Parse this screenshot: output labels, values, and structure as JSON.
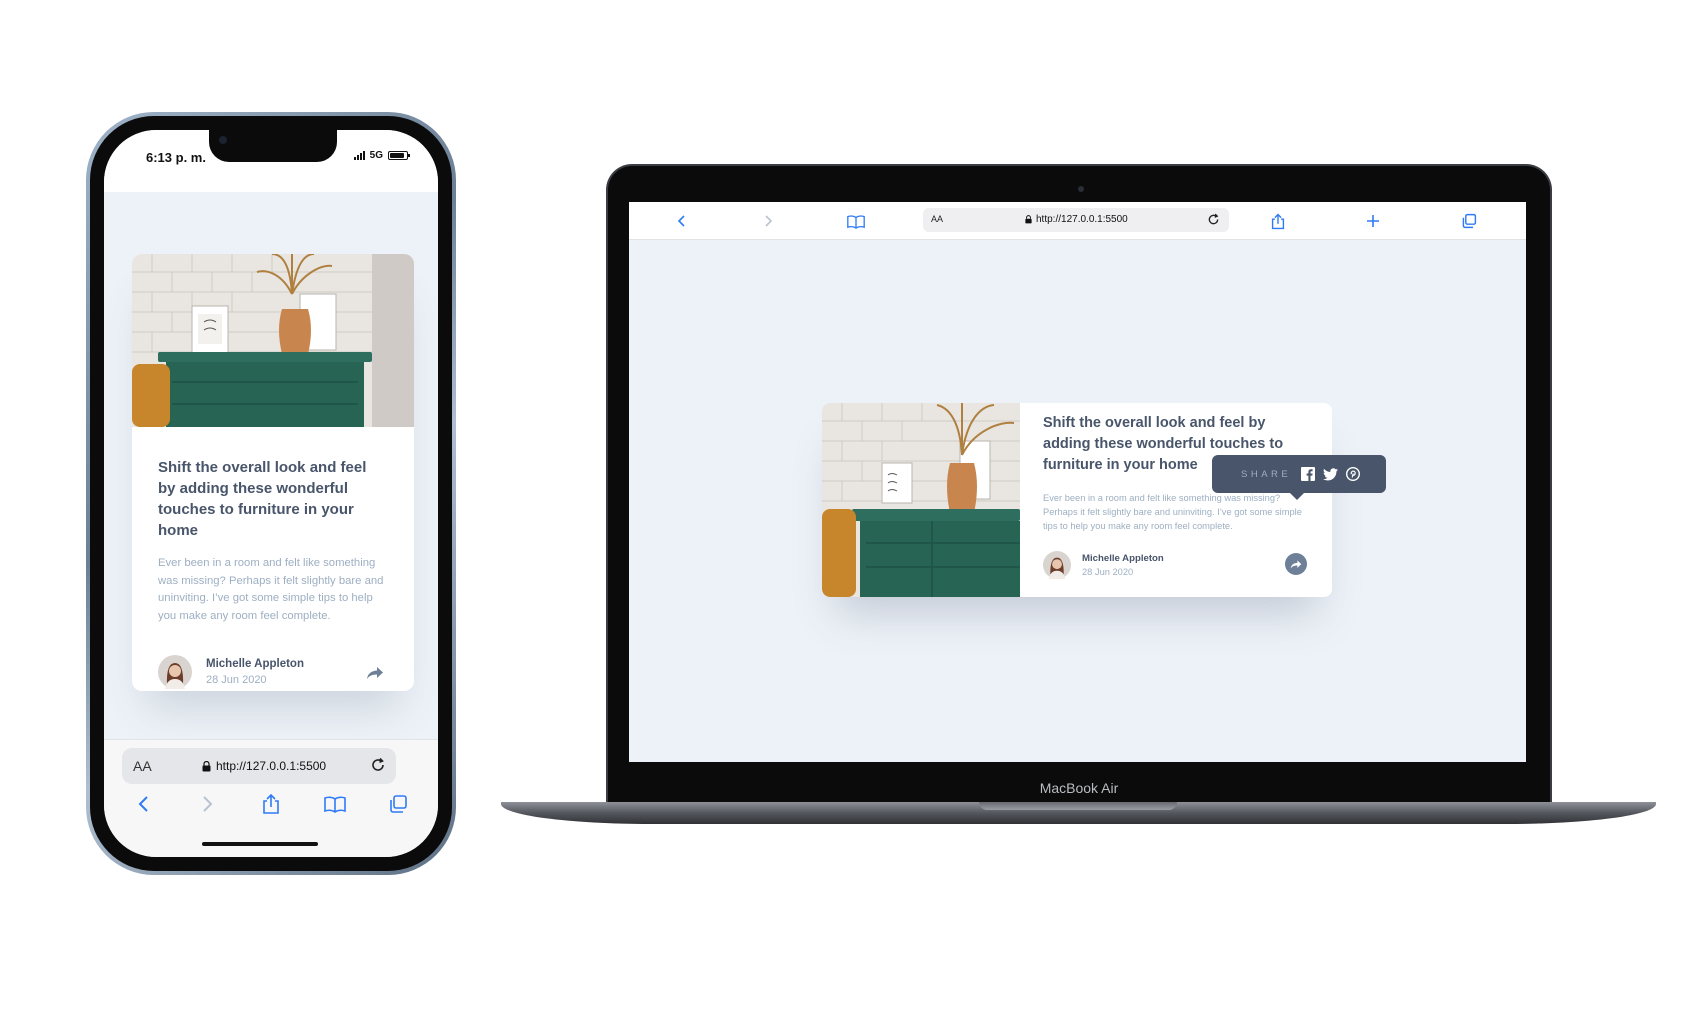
{
  "phone": {
    "status": {
      "time": "6:13 p. m.",
      "network": "5G"
    },
    "card": {
      "title": "Shift the overall look and feel by adding these wonderful touches to furniture in your home",
      "description": "Ever been in a room and felt like something was missing? Perhaps it felt slightly bare and uninviting. I’ve got some simple tips to help you make any room feel complete.",
      "author": "Michelle Appleton",
      "date": "28 Jun 2020"
    },
    "browser": {
      "aa_label": "AA",
      "url": "http://127.0.0.1:5500"
    }
  },
  "laptop": {
    "brand": "MacBook Air",
    "browser": {
      "aa_label": "AA",
      "url": "http://127.0.0.1:5500"
    },
    "card": {
      "title": "Shift the overall look and feel by adding these wonderful touches to furniture in your home",
      "description": "Ever been in a room and felt like something was missing? Perhaps it felt slightly bare and uninviting. I’ve got some simple tips to help you make any room feel complete.",
      "author": "Michelle Appleton",
      "date": "28 Jun 2020"
    },
    "share_popup": {
      "label": "SHARE",
      "icons": [
        "facebook-icon",
        "twitter-icon",
        "pinterest-icon"
      ]
    }
  },
  "colors": {
    "page_bg": "#ecf2f8",
    "card_bg": "#ffffff",
    "title": "#48556a",
    "muted": "#9eafc2",
    "share_dark": "#48556a",
    "share_btn": "#6e8098",
    "browser_blue": "#2f7bf5"
  }
}
